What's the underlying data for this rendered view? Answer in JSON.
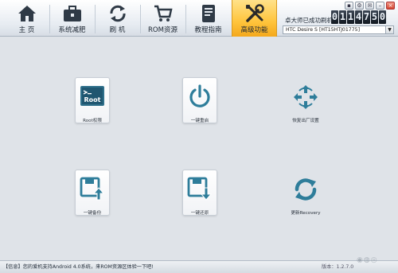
{
  "nav": {
    "tabs": [
      {
        "label": "主 页",
        "icon": "home-icon"
      },
      {
        "label": "系统减肥",
        "icon": "toolbox-icon"
      },
      {
        "label": "刷 机",
        "icon": "refresh-icon"
      },
      {
        "label": "ROM资源",
        "icon": "cart-icon"
      },
      {
        "label": "教程指南",
        "icon": "book-icon"
      },
      {
        "label": "高级功能",
        "icon": "tools-icon"
      }
    ],
    "active_index": 5
  },
  "device": {
    "flash_label": "卓大师已成功刷机",
    "counter_digits": [
      "0",
      "1",
      "1",
      "4",
      "7",
      "5",
      "0"
    ],
    "selected_device": "HTC Desire S [HT15HTJ01775]"
  },
  "window_controls": [
    "minimize-icon",
    "skin-icon",
    "chat-icon",
    "menu-icon",
    "close-icon"
  ],
  "tools": [
    {
      "label": "Root权限",
      "icon": "terminal-root-icon",
      "icon_text": "Root"
    },
    {
      "label": "一键重启",
      "icon": "power-icon"
    },
    {
      "label": "恢复出厂设置",
      "icon": "factory-reset-icon"
    },
    {
      "label": "一键备份",
      "icon": "backup-icon"
    },
    {
      "label": "一键还原",
      "icon": "restore-icon"
    },
    {
      "label": "更新Recovery",
      "icon": "update-recovery-icon"
    }
  ],
  "status": {
    "message": "【信息】您的爱机支持Android 4.0系统，来ROM资源区体验一下吧!",
    "version": "版本：1.2.7.0"
  },
  "colors": {
    "accent_teal": "#2e7d9a",
    "active_tab": "#ffc43c",
    "background": "#dfe3e8"
  }
}
